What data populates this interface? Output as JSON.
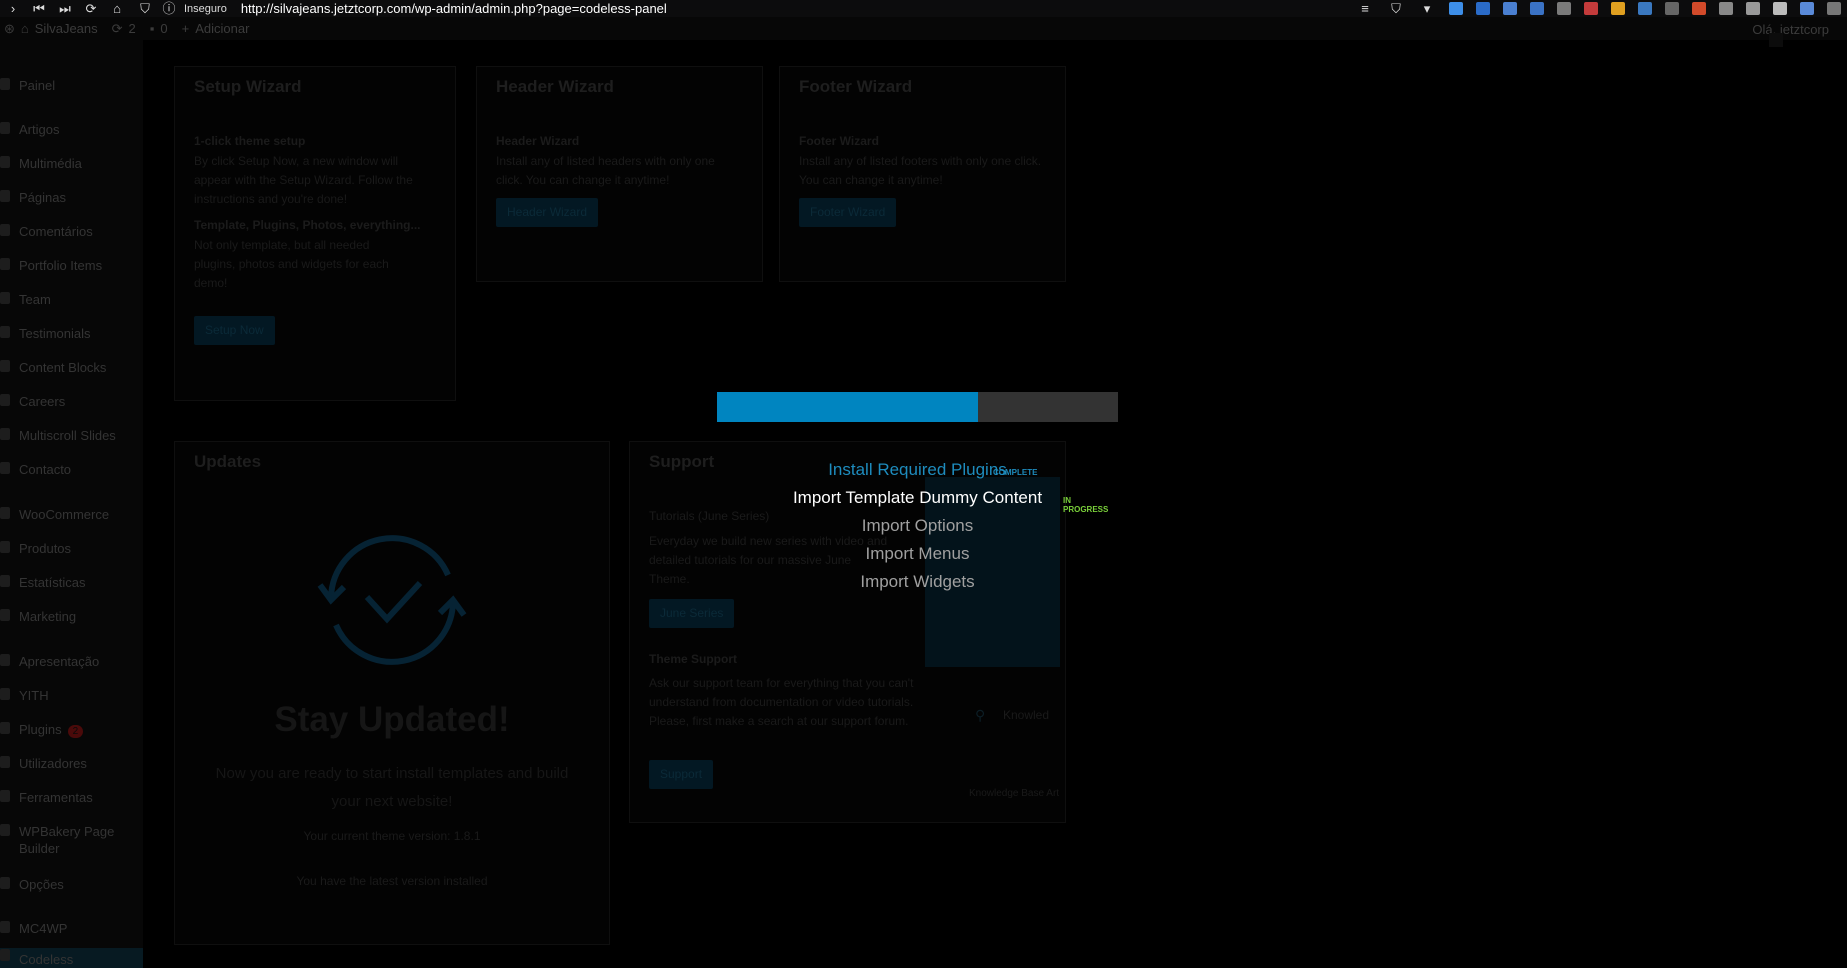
{
  "browser": {
    "insecure_label": "Inseguro",
    "url": "http://silvajeans.jetztcorp.com/wp-admin/admin.php?page=codeless-panel"
  },
  "adminbar": {
    "site_name": "SilvaJeans",
    "updates_count": "2",
    "comments_count": "0",
    "add_new": "Adicionar",
    "greeting": "Olá, jetztcorp"
  },
  "sidebar": {
    "items": [
      {
        "label": "Painel"
      },
      {
        "label": "Artigos"
      },
      {
        "label": "Multimédia"
      },
      {
        "label": "Páginas"
      },
      {
        "label": "Comentários"
      },
      {
        "label": "Portfolio Items"
      },
      {
        "label": "Team"
      },
      {
        "label": "Testimonials"
      },
      {
        "label": "Content Blocks"
      },
      {
        "label": "Careers"
      },
      {
        "label": "Multiscroll Slides"
      },
      {
        "label": "Contacto"
      },
      {
        "label": "WooCommerce"
      },
      {
        "label": "Produtos"
      },
      {
        "label": "Estatísticas"
      },
      {
        "label": "Marketing"
      },
      {
        "label": "Apresentação"
      },
      {
        "label": "YITH"
      },
      {
        "label": "Plugins",
        "badge": "2"
      },
      {
        "label": "Utilizadores"
      },
      {
        "label": "Ferramentas"
      },
      {
        "label": "WPBakery Page Builder"
      },
      {
        "label": "Opções"
      },
      {
        "label": "MC4WP"
      },
      {
        "label": "Codeless"
      }
    ]
  },
  "setup_wizard": {
    "title": "Setup Wizard",
    "subtitle": "1-click theme setup",
    "desc": "By click Setup Now, a new window will appear with the Setup Wizard. Follow the instructions and you're done!",
    "subtitle2": "Template, Plugins, Photos, everything...",
    "desc2": "Not only template, but all needed plugins, photos and widgets for each demo!",
    "button": "Setup Now"
  },
  "header_wizard": {
    "title": "Header Wizard",
    "subtitle": "Header Wizard",
    "desc": "Install any of listed headers with only one click. You can change it anytime!",
    "button": "Header Wizard"
  },
  "footer_wizard": {
    "title": "Footer Wizard",
    "subtitle": "Footer Wizard",
    "desc": "Install any of listed footers with only one click. You can change it anytime!",
    "button": "Footer Wizard"
  },
  "updates": {
    "title": "Updates",
    "heading": "Stay Updated!",
    "desc": "Now you are ready to start install templates and build your next website!",
    "version": "Your current theme version: 1.8.1",
    "latest": "You have the latest version installed"
  },
  "support": {
    "title": "Support",
    "tutorials_title": "Tutorials (June Series)",
    "tutorials_desc": "Everyday we build new series with video and detailed tutorials for our massive June Theme.",
    "tutorials_button": "June Series",
    "support_title": "Theme Support",
    "support_desc": "Ask our support team for everything that you can't understand from documentation or video tutorials. Please, first make a search at our support forum.",
    "support_button": "Support",
    "kb_label": "Knowled",
    "kb_footer": "Knowledge Base Art"
  },
  "import": {
    "progress": 0.65,
    "steps": [
      {
        "label": "Install Required Plugins",
        "status": "COMPLETE"
      },
      {
        "label": "Import Template Dummy Content",
        "status": "IN PROGRESS"
      },
      {
        "label": "Import Options",
        "status": ""
      },
      {
        "label": "Import Menus",
        "status": ""
      },
      {
        "label": "Import Widgets",
        "status": ""
      }
    ],
    "colors": {
      "complete": "#1e8cbe",
      "in_progress": "#7ad03a",
      "bar": "#0085c0"
    }
  }
}
